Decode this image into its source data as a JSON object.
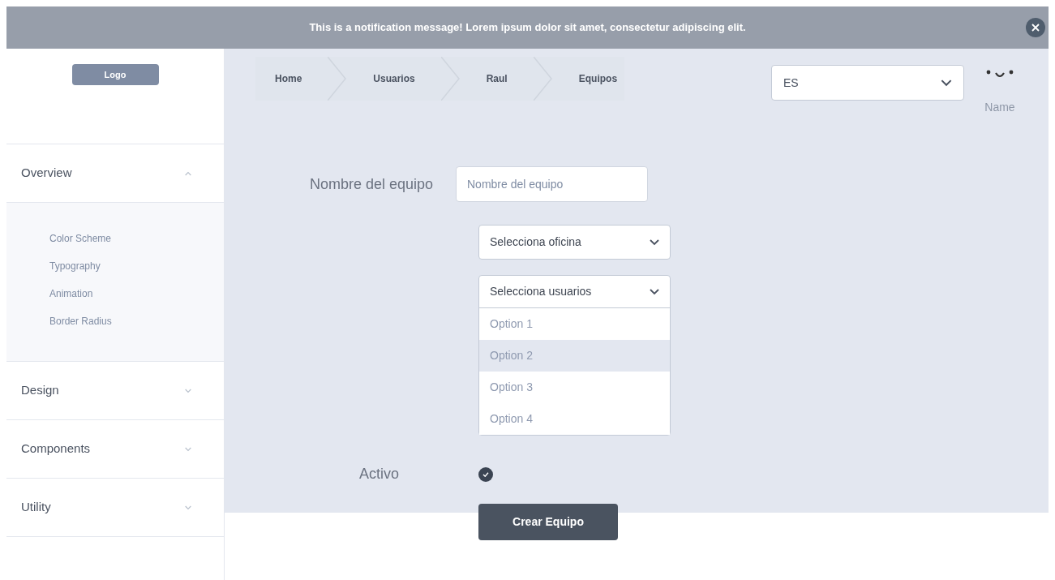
{
  "notification": {
    "message": "This is a notification message! Lorem ipsum dolor sit amet, consectetur adipiscing elit."
  },
  "sidebar": {
    "logo": "Logo",
    "sections": [
      {
        "label": "Overview",
        "expanded": true,
        "children": [
          {
            "label": "Color Scheme"
          },
          {
            "label": "Typography"
          },
          {
            "label": "Animation"
          },
          {
            "label": "Border Radius"
          }
        ]
      },
      {
        "label": "Design",
        "expanded": false
      },
      {
        "label": "Components",
        "expanded": false
      },
      {
        "label": "Utility",
        "expanded": false
      }
    ]
  },
  "breadcrumb": [
    "Home",
    "Usuarios",
    "Raul",
    "Equipos"
  ],
  "language": {
    "value": "ES"
  },
  "user": {
    "name": "Name"
  },
  "form": {
    "name_label": "Nombre del equipo",
    "name_placeholder": "Nombre del equipo",
    "office_select": "Selecciona oficina",
    "users_select": "Selecciona usuarios",
    "options": [
      {
        "label": "Option 1",
        "selected": false
      },
      {
        "label": "Option 2",
        "selected": true
      },
      {
        "label": "Option 3",
        "selected": false
      },
      {
        "label": "Option 4",
        "selected": false
      }
    ],
    "active_label": "Activo",
    "active_checked": true,
    "submit": "Crear Equipo"
  }
}
